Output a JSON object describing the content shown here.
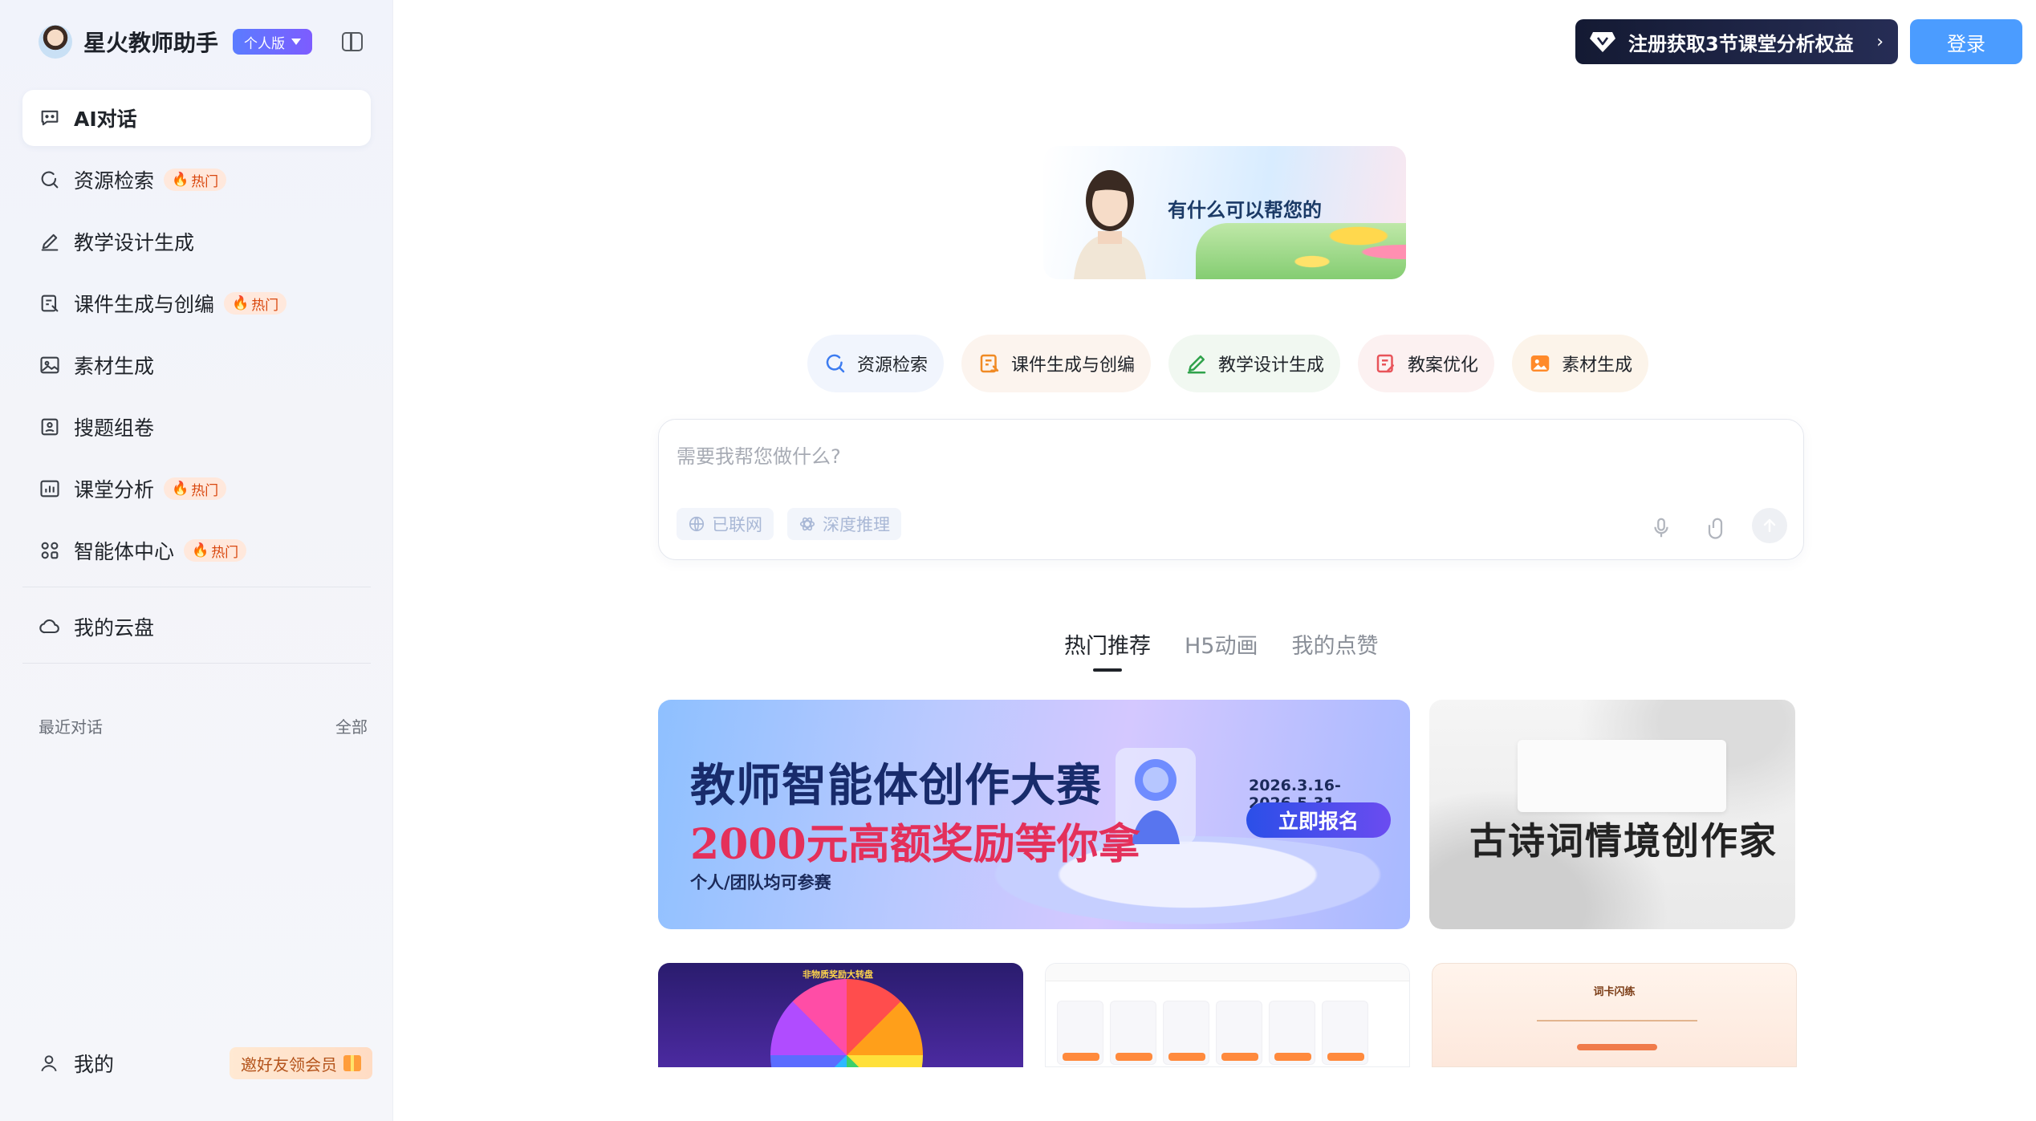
{
  "sidebar": {
    "app_name": "星火教师助手",
    "plan_badge": "个人版",
    "nav": [
      {
        "label": "AI对话",
        "icon": "chat-icon",
        "active": true
      },
      {
        "label": "资源检索",
        "icon": "search-icon",
        "hot": "热门"
      },
      {
        "label": "教学设计生成",
        "icon": "pen-icon"
      },
      {
        "label": "课件生成与创编",
        "icon": "courseware-icon",
        "hot": "热门"
      },
      {
        "label": "素材生成",
        "icon": "image-icon"
      },
      {
        "label": "搜题组卷",
        "icon": "quiz-icon"
      },
      {
        "label": "课堂分析",
        "icon": "chart-icon",
        "hot": "热门"
      },
      {
        "label": "智能体中心",
        "icon": "apps-icon",
        "hot": "热门"
      },
      {
        "label": "我的云盘",
        "icon": "cloud-icon"
      }
    ],
    "recent_title": "最近对话",
    "recent_all": "全部",
    "me_label": "我的",
    "invite_label": "邀好友领会员"
  },
  "header": {
    "promo_text": "注册获取3节课堂分析权益",
    "login_label": "登录"
  },
  "hero": {
    "greeting": "有什么可以帮您的"
  },
  "quick_actions": [
    {
      "label": "资源检索",
      "icon": "search-icon"
    },
    {
      "label": "课件生成与创编",
      "icon": "courseware-icon"
    },
    {
      "label": "教学设计生成",
      "icon": "pen-icon"
    },
    {
      "label": "教案优化",
      "icon": "doc-edit-icon"
    },
    {
      "label": "素材生成",
      "icon": "image-icon"
    }
  ],
  "composer": {
    "placeholder": "需要我帮您做什么?",
    "web_toggle": "已联网",
    "reasoning_toggle": "深度推理"
  },
  "tabs": [
    {
      "label": "热门推荐",
      "active": true
    },
    {
      "label": "H5动画"
    },
    {
      "label": "我的点赞"
    }
  ],
  "cards": {
    "contest": {
      "title": "教师智能体创作大赛",
      "subtitle": "2000元高额奖励等你拿",
      "note": "个人/团队均可参赛",
      "date": "2026.3.16-2026.5.31",
      "cta": "立即报名"
    },
    "poetry": {
      "title": "古诗词情境创作家"
    },
    "wheel": {
      "title": "非物质奖励大转盘"
    },
    "flashcard": {
      "title": "词卡闪练"
    }
  },
  "colors": {
    "accent": "#4b9cff",
    "badge_start": "#5b7cff",
    "badge_end": "#7d5cff",
    "hot_bg": "#ffe8dc",
    "promo_bg": "#141a33"
  }
}
